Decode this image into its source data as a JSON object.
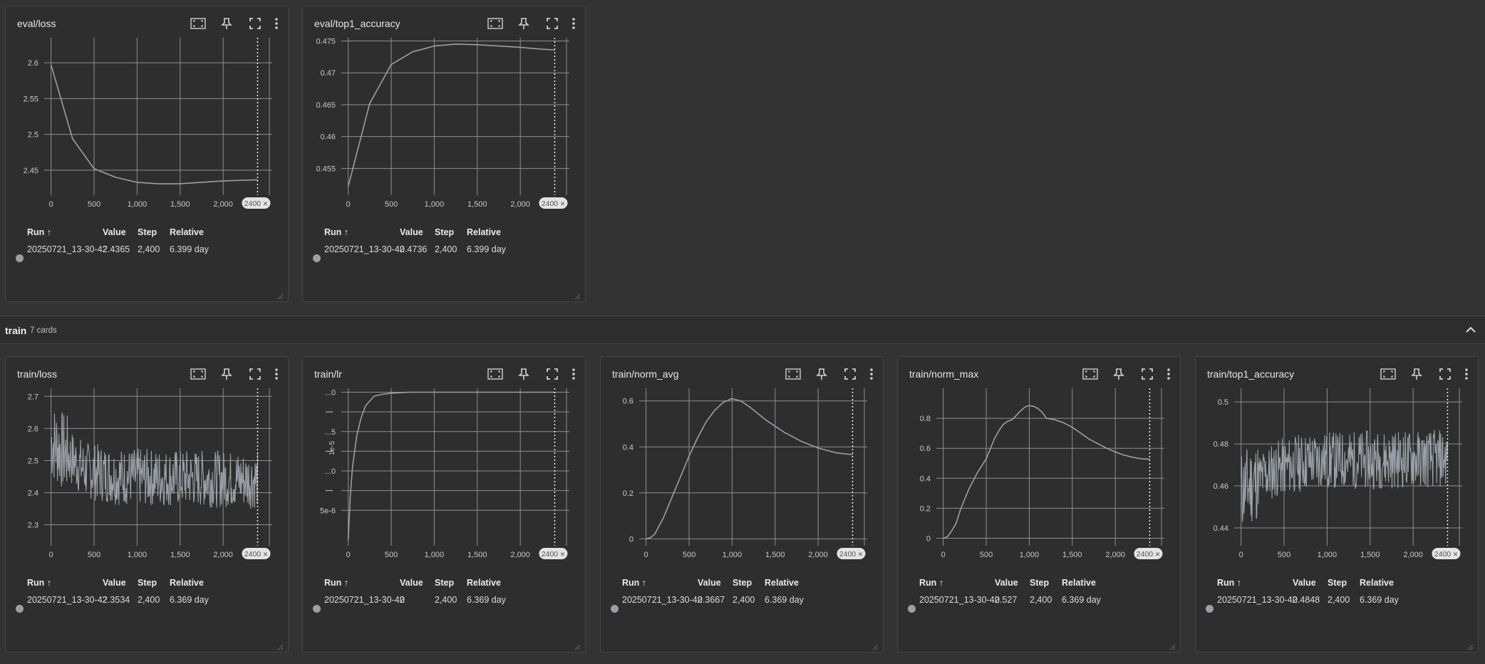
{
  "common": {
    "table_headers": {
      "run": "Run ↑",
      "value": "Value",
      "step": "Step",
      "relative": "Relative"
    },
    "step_chip": "2400",
    "step_chip_close": "✕",
    "series_color": "#9aa0a8"
  },
  "sections": [
    {
      "title": "train",
      "count_label": "7 cards"
    }
  ],
  "cards": [
    {
      "id": "eval_loss",
      "title": "eval/loss",
      "row": {
        "run": "20250721_13-30-42",
        "value": "2.4365",
        "step": "2,400",
        "relative": "6.399 day"
      },
      "chart_data": {
        "type": "line",
        "x_range": [
          -80,
          2570
        ],
        "ylim": [
          2.415,
          2.635
        ],
        "x_ticks": [
          0,
          500,
          1000,
          1500,
          2000
        ],
        "x_tick_labels": [
          "0",
          "500",
          "1,000",
          "1,500",
          "2,000"
        ],
        "y_ticks": [
          2.45,
          2.5,
          2.55,
          2.6
        ],
        "y_tick_labels": [
          "2.45",
          "2.5",
          "2.55",
          "2.6"
        ],
        "step_marker": 2400,
        "series": [
          {
            "x": [
              0,
              250,
              500,
              750,
              1000,
              1250,
              1500,
              1750,
              2000,
              2250,
              2400
            ],
            "y": [
              2.597,
              2.494,
              2.452,
              2.44,
              2.433,
              2.431,
              2.431,
              2.433,
              2.435,
              2.436,
              2.4365
            ]
          }
        ]
      }
    },
    {
      "id": "eval_top1",
      "title": "eval/top1_accuracy",
      "row": {
        "run": "20250721_13-30-42",
        "value": "0.4736",
        "step": "2,400",
        "relative": "6.399 day"
      },
      "chart_data": {
        "type": "line",
        "x_range": [
          -80,
          2570
        ],
        "ylim": [
          0.4508,
          0.4755
        ],
        "x_ticks": [
          0,
          500,
          1000,
          1500,
          2000
        ],
        "x_tick_labels": [
          "0",
          "500",
          "1,000",
          "1,500",
          "2,000"
        ],
        "y_ticks": [
          0.455,
          0.46,
          0.465,
          0.47,
          0.475
        ],
        "y_tick_labels": [
          "0.455",
          "0.46",
          "0.465",
          "0.47",
          "0.475"
        ],
        "step_marker": 2400,
        "series": [
          {
            "x": [
              0,
              250,
              500,
              750,
              1000,
              1250,
              1500,
              1750,
              2000,
              2250,
              2400
            ],
            "y": [
              0.4522,
              0.4652,
              0.4713,
              0.4733,
              0.4742,
              0.4745,
              0.4744,
              0.4742,
              0.474,
              0.4737,
              0.4736
            ]
          }
        ]
      }
    },
    {
      "id": "train_loss",
      "title": "train/loss",
      "row": {
        "run": "20250721_13-30-42",
        "value": "2.3534",
        "step": "2,400",
        "relative": "6.369 day"
      },
      "chart_data": {
        "type": "line",
        "x_range": [
          -80,
          2570
        ],
        "ylim": [
          2.235,
          2.725
        ],
        "x_ticks": [
          0,
          500,
          1000,
          1500,
          2000
        ],
        "x_tick_labels": [
          "0",
          "500",
          "1,000",
          "1,500",
          "2,000"
        ],
        "y_ticks": [
          2.3,
          2.4,
          2.5,
          2.6,
          2.7
        ],
        "y_tick_labels": [
          "2.3",
          "2.4",
          "2.5",
          "2.6",
          "2.7"
        ],
        "step_marker": 2400,
        "noisy": {
          "x_start": 0,
          "x_end": 2400,
          "n": 420,
          "trend_x": [
            0,
            400,
            800,
            2400
          ],
          "trend_y": [
            2.56,
            2.47,
            2.45,
            2.44
          ],
          "amplitude": 0.09,
          "seed": 7
        }
      }
    },
    {
      "id": "train_lr",
      "title": "train/lr",
      "row": {
        "run": "20250721_13-30-42",
        "value": "0",
        "step": "2,400",
        "relative": "6.369 day"
      },
      "chart_data": {
        "type": "line",
        "x_range": [
          -80,
          2570
        ],
        "ylim": [
          3.2e-06,
          1.12e-05
        ],
        "x_ticks": [
          0,
          500,
          1000,
          1500,
          2000
        ],
        "x_tick_labels": [
          "0",
          "500",
          "1,000",
          "1,500",
          "2,000"
        ],
        "y_ticks": [
          5e-06,
          6e-06,
          7e-06,
          8e-06,
          9e-06,
          1e-05,
          1.1e-05
        ],
        "y_tick_labels": [
          "5e-6",
          "",
          "...0",
          "",
          "...5",
          "",
          "...0"
        ],
        "y_exponent_label": "1e-5",
        "step_marker": 2400,
        "series": [
          {
            "x": [
              0,
              25,
              50,
              100,
              150,
              200,
              300,
              400,
              500,
              700,
              1000,
              1500,
              2000,
              2400
            ],
            "y": [
              3.5e-06,
              5.8e-06,
              7.2e-06,
              8.8e-06,
              9.7e-06,
              1.03e-05,
              1.08e-05,
              1.09e-05,
              1.095e-05,
              1.1e-05,
              1.1e-05,
              1.1e-05,
              1.1e-05,
              1.1e-05
            ]
          }
        ]
      }
    },
    {
      "id": "train_norm_avg",
      "title": "train/norm_avg",
      "row": {
        "run": "20250721_13-30-42",
        "value": "0.3667",
        "step": "2,400",
        "relative": "6.369 day"
      },
      "chart_data": {
        "type": "line",
        "x_range": [
          -80,
          2570
        ],
        "ylim": [
          -0.03,
          0.655
        ],
        "x_ticks": [
          0,
          500,
          1000,
          1500,
          2000
        ],
        "x_tick_labels": [
          "0",
          "500",
          "1,000",
          "1,500",
          "2,000"
        ],
        "y_ticks": [
          0,
          0.2,
          0.4,
          0.6
        ],
        "y_tick_labels": [
          "0",
          "0.2",
          "0.4",
          "0.6"
        ],
        "step_marker": 2400,
        "series": [
          {
            "x": [
              0,
              50,
              100,
              200,
              300,
              400,
              500,
              600,
              700,
              800,
              900,
              1000,
              1100,
              1200,
              1300,
              1400,
              1500,
              1600,
              1700,
              1800,
              1900,
              2000,
              2100,
              2200,
              2300,
              2400
            ],
            "y": [
              0,
              0.005,
              0.02,
              0.09,
              0.18,
              0.27,
              0.36,
              0.44,
              0.51,
              0.56,
              0.595,
              0.61,
              0.6,
              0.575,
              0.545,
              0.515,
              0.49,
              0.465,
              0.445,
              0.425,
              0.41,
              0.395,
              0.385,
              0.375,
              0.37,
              0.3667
            ]
          }
        ]
      }
    },
    {
      "id": "train_norm_max",
      "title": "train/norm_max",
      "row": {
        "run": "20250721_13-30-42",
        "value": "0.527",
        "step": "2,400",
        "relative": "6.369 day"
      },
      "chart_data": {
        "type": "line",
        "x_range": [
          -80,
          2570
        ],
        "ylim": [
          -0.05,
          1.0
        ],
        "x_ticks": [
          0,
          500,
          1000,
          1500,
          2000
        ],
        "x_tick_labels": [
          "0",
          "500",
          "1,000",
          "1,500",
          "2,000"
        ],
        "y_ticks": [
          0,
          0.2,
          0.4,
          0.6,
          0.8
        ],
        "y_tick_labels": [
          "0",
          "0.2",
          "0.4",
          "0.6",
          "0.8"
        ],
        "step_marker": 2400,
        "series": [
          {
            "x": [
              0,
              50,
              100,
              150,
              200,
              300,
              400,
              500,
              550,
              600,
              650,
              700,
              750,
              800,
              850,
              900,
              950,
              1000,
              1050,
              1100,
              1150,
              1200,
              1300,
              1400,
              1500,
              1600,
              1700,
              1800,
              1900,
              2000,
              2100,
              2200,
              2300,
              2400
            ],
            "y": [
              0,
              0.01,
              0.05,
              0.1,
              0.19,
              0.33,
              0.44,
              0.53,
              0.6,
              0.67,
              0.72,
              0.76,
              0.78,
              0.79,
              0.82,
              0.85,
              0.875,
              0.885,
              0.88,
              0.865,
              0.84,
              0.8,
              0.79,
              0.77,
              0.74,
              0.7,
              0.66,
              0.63,
              0.6,
              0.575,
              0.555,
              0.54,
              0.53,
              0.527
            ]
          }
        ]
      }
    },
    {
      "id": "train_top1",
      "title": "train/top1_accuracy",
      "row": {
        "run": "20250721_13-30-42",
        "value": "0.4848",
        "step": "2,400",
        "relative": "6.369 day"
      },
      "chart_data": {
        "type": "line",
        "x_range": [
          -80,
          2570
        ],
        "ylim": [
          0.4315,
          0.5065
        ],
        "x_ticks": [
          0,
          500,
          1000,
          1500,
          2000
        ],
        "x_tick_labels": [
          "0",
          "500",
          "1,000",
          "1,500",
          "2,000"
        ],
        "y_ticks": [
          0.44,
          0.46,
          0.48,
          0.5
        ],
        "y_tick_labels": [
          "0.44",
          "0.46",
          "0.48",
          "0.5"
        ],
        "step_marker": 2400,
        "noisy": {
          "x_start": 0,
          "x_end": 2400,
          "n": 420,
          "trend_x": [
            0,
            400,
            800,
            2400
          ],
          "trend_y": [
            0.458,
            0.468,
            0.472,
            0.473
          ],
          "amplitude": 0.014,
          "seed": 11
        }
      }
    }
  ]
}
